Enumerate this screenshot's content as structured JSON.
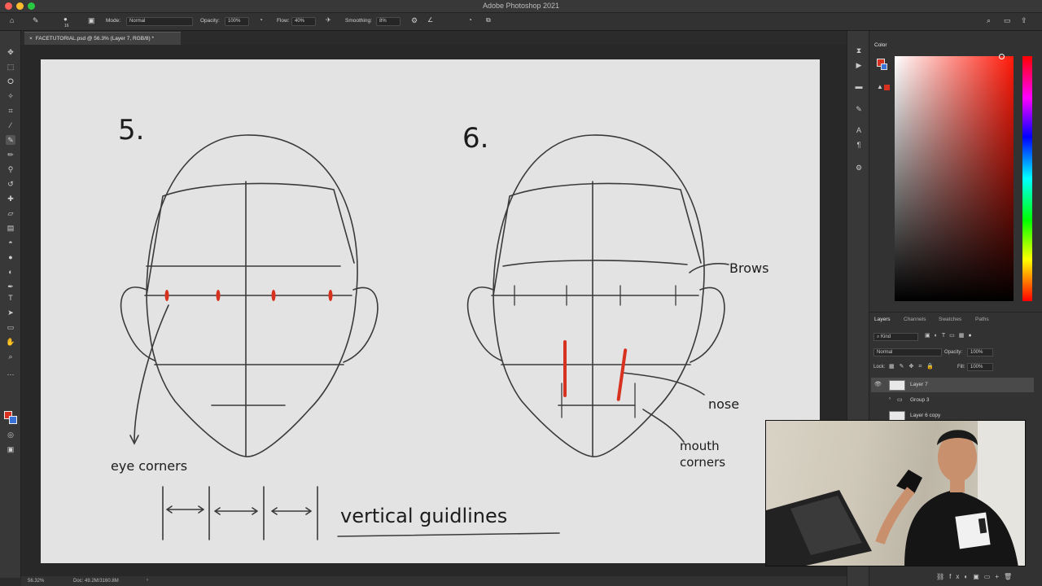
{
  "app": {
    "title": "Adobe Photoshop 2021"
  },
  "options_bar": {
    "mode_label": "Mode:",
    "mode_value": "Normal",
    "opacity_label": "Opacity:",
    "opacity_value": "100%",
    "flow_label": "Flow:",
    "flow_value": "40%",
    "smoothing_label": "Smoothing:",
    "smoothing_value": "8%",
    "brush_size": "16"
  },
  "document_tab": {
    "label": "FACETUTORIAL.psd @ 56.3% (Layer 7, RGB/8) *"
  },
  "canvas": {
    "step_left": "5.",
    "step_right": "6.",
    "label_eye_corners": "eye corners",
    "label_vertical_guidlines": "vertical guidlines",
    "label_brows": "Brows",
    "label_nose": "nose",
    "label_mouth": "mouth",
    "label_corners": "corners"
  },
  "status_bar": {
    "zoom": "56.32%",
    "doc": "Doc: 49.2M/3160.8M"
  },
  "panels": {
    "color_tab": "Color",
    "layers_tabs": [
      "Layers",
      "Channels",
      "Swatches",
      "Paths"
    ],
    "kind_filter": "Kind",
    "blend_mode": "Normal",
    "opacity_label": "Opacity:",
    "opacity_value": "100%",
    "lock_label": "Lock:",
    "fill_label": "Fill:",
    "fill_value": "100%",
    "layers": [
      "Layer 7",
      "Group 3",
      "Layer 6 copy"
    ]
  },
  "colors": {
    "foreground": "#d7321f",
    "background": "#3a72d8",
    "accent_red": "#d7321f"
  }
}
